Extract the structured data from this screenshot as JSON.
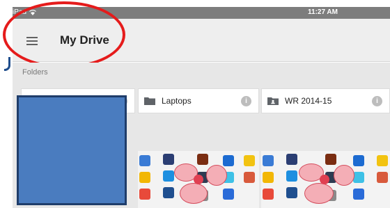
{
  "status_bar": {
    "device": "iPad",
    "time": "11:27 AM"
  },
  "app_bar": {
    "title": "My Drive"
  },
  "section": {
    "label": "Folders"
  },
  "folders": [
    {
      "name": "Laptops",
      "icon": "folder-icon"
    },
    {
      "name": "WR 2014-15",
      "icon": "shared-folder-icon"
    }
  ],
  "colors": {
    "annotation_oval": "#e51b1b",
    "redaction_fill": "#4a7cbf",
    "status_bar": "#7d7d7d",
    "app_bar": "#eeeeee"
  }
}
